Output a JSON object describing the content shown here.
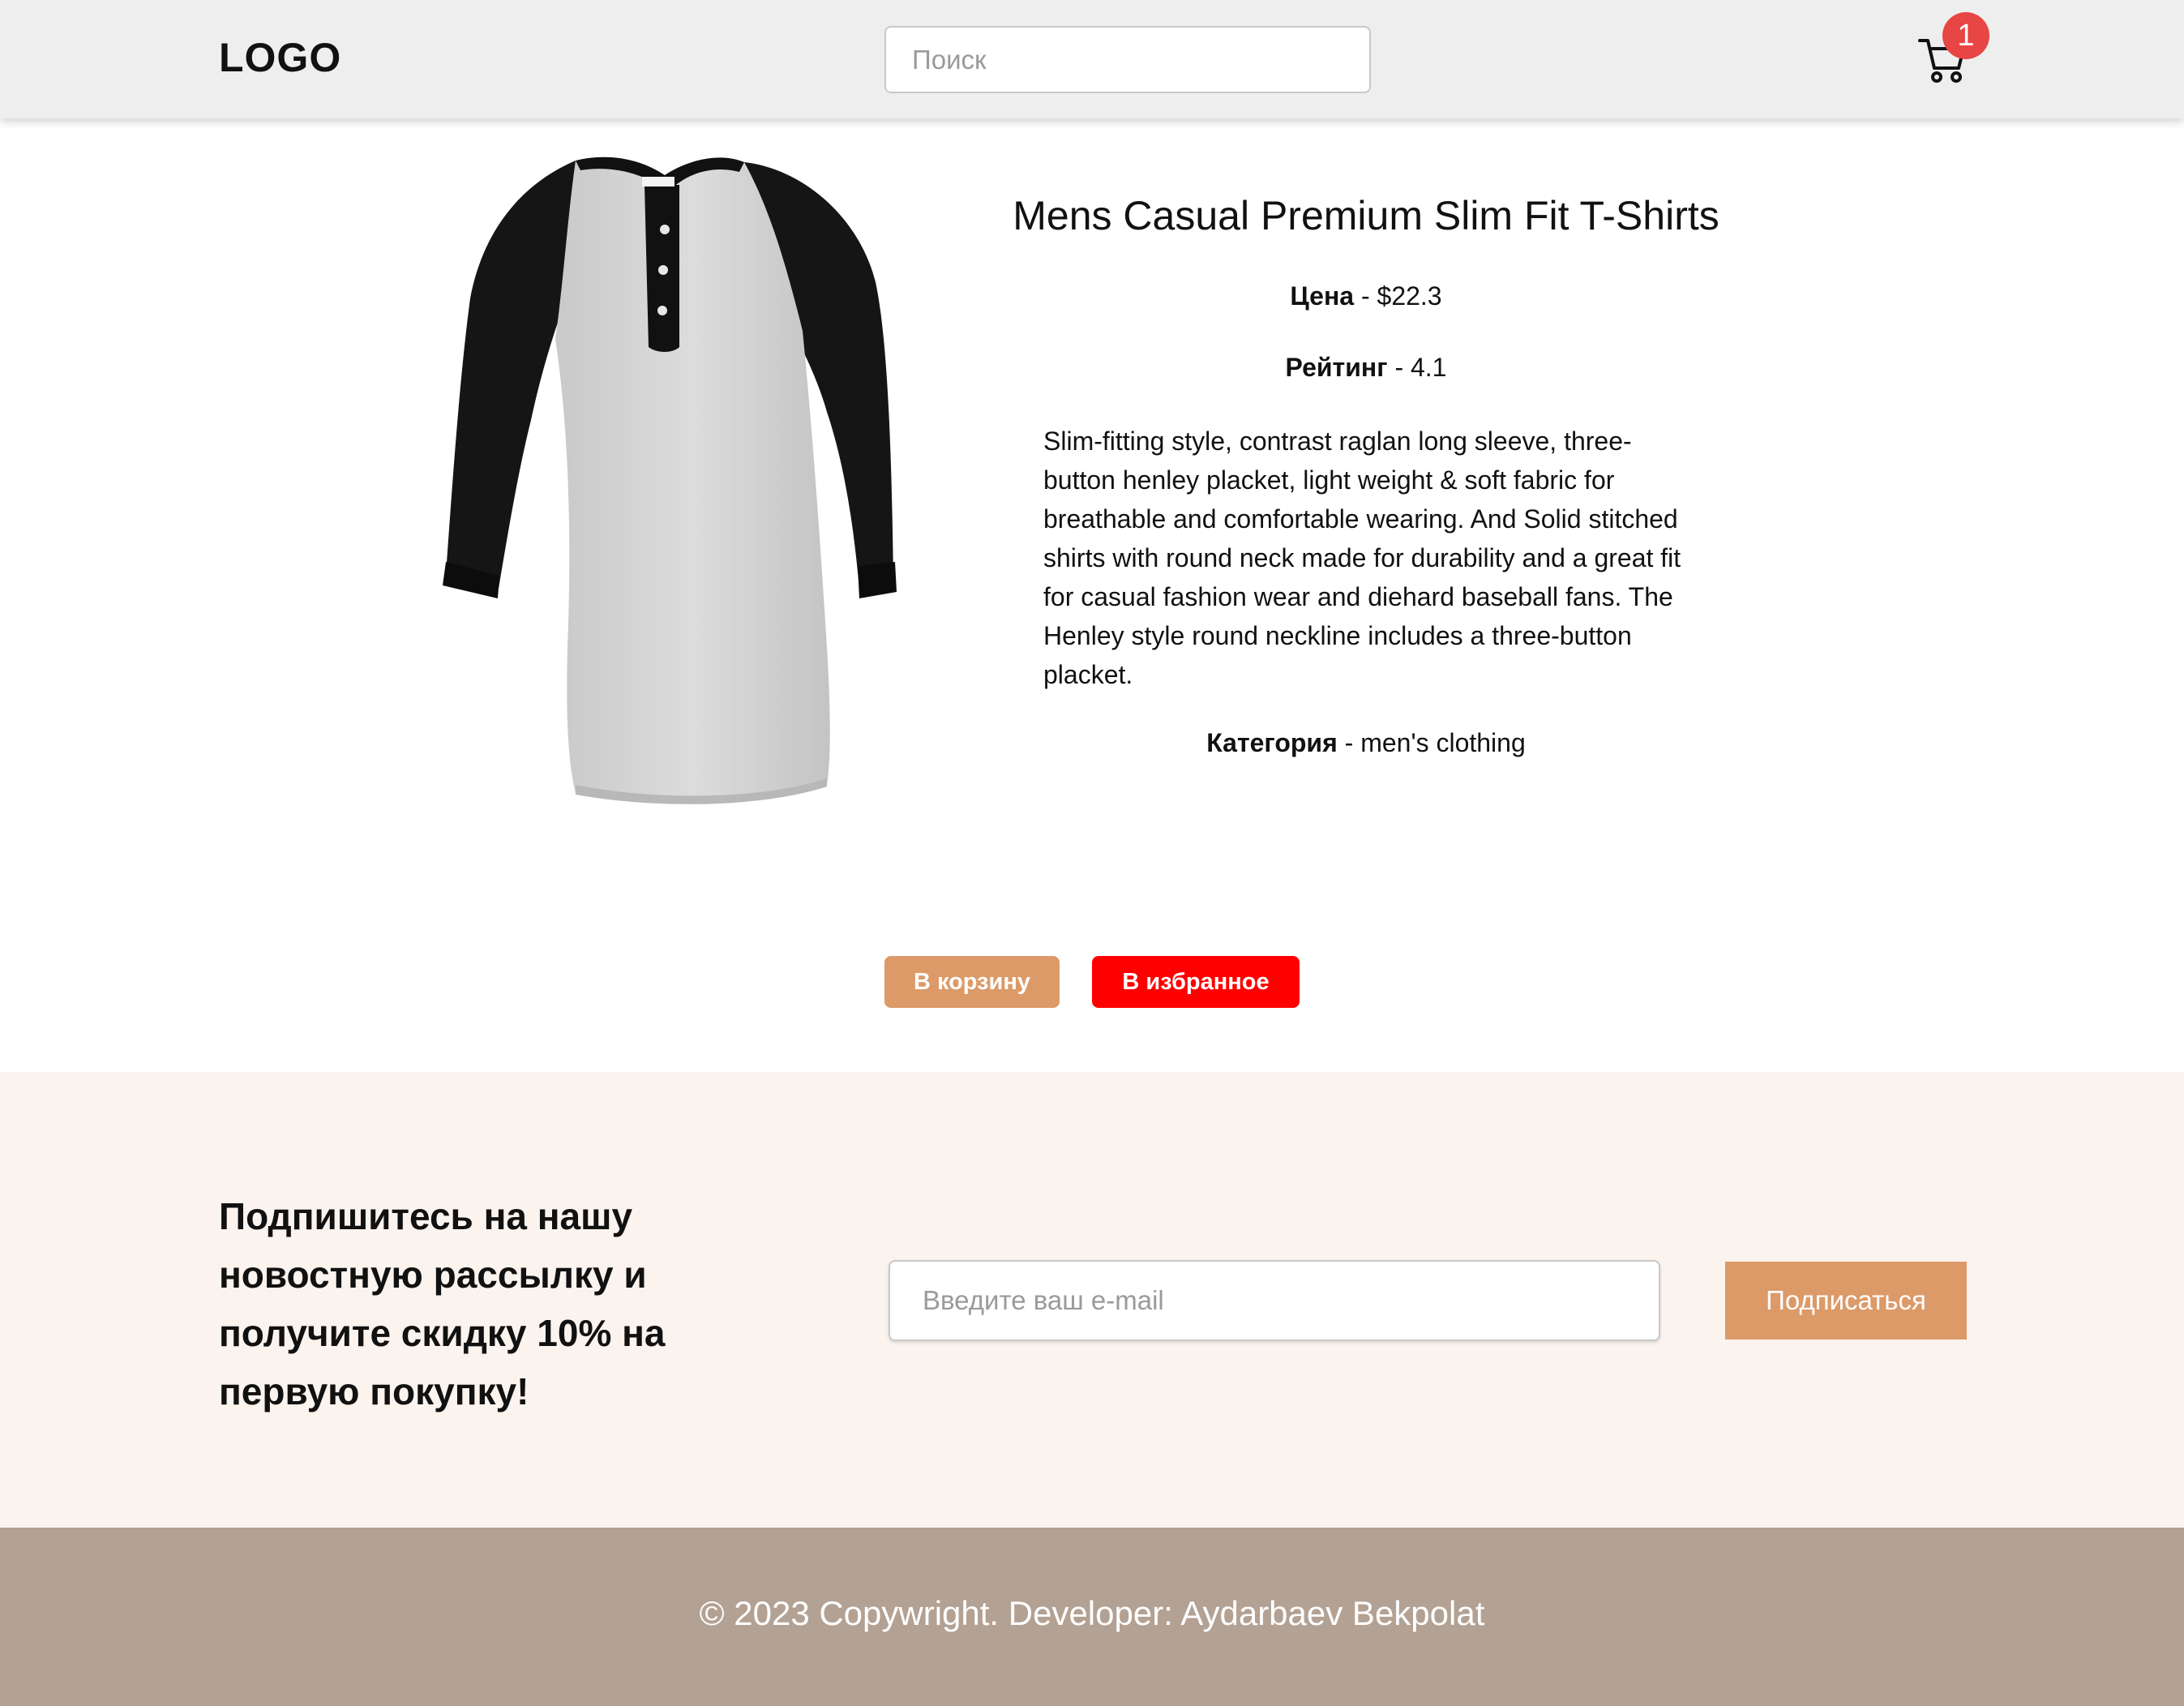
{
  "header": {
    "logo": "LOGO",
    "search_placeholder": "Поиск",
    "cart_count": "1",
    "cart_icon": "shopping-cart-icon"
  },
  "product": {
    "image_alt": "Raglan henley t-shirt, heather grey body with black sleeves",
    "title": "Mens Casual Premium Slim Fit T-Shirts",
    "price_label": "Цена",
    "price_value": " - $22.3",
    "rating_label": "Рейтинг",
    "rating_value": " - 4.1",
    "description": "Slim-fitting style, contrast raglan long sleeve, three-button henley placket, light weight & soft fabric for breathable and comfortable wearing. And Solid stitched shirts with round neck made for durability and a great fit for casual fashion wear and diehard baseball fans. The Henley style round neckline includes a three-button placket.",
    "category_label": "Категория",
    "category_value": " - men's clothing",
    "add_to_cart_label": "В корзину",
    "add_to_favorites_label": "В избранное"
  },
  "newsletter": {
    "title": "Подпишитесь на нашу новостную рассылку и получите скидку 10% на первую покупку!",
    "email_placeholder": "Введите ваш e-mail",
    "subscribe_label": "Подписаться"
  },
  "footer": {
    "copyright": "© 2023 Copywright. Developer: Aydarbaev Bekpolat"
  },
  "colors": {
    "header_bg": "#eeeeee",
    "accent": "#dc9a68",
    "favorite": "#ff0000",
    "badge": "#e84545",
    "newsletter_bg": "#fbf3ee",
    "footer_bg": "#b3a193"
  }
}
